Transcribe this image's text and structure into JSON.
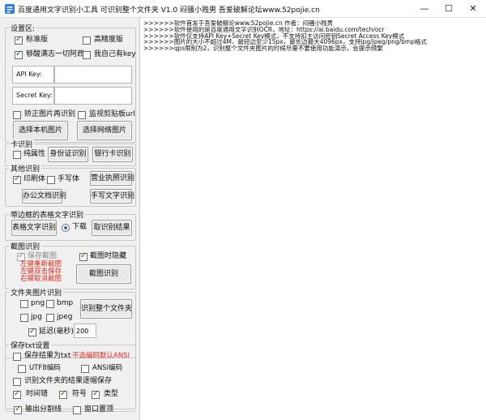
{
  "window": {
    "title": "百度通用文字识别小工具 可识别整个文件夹 V1.0  闷骚小贱男   吾爱破解论坛www.52pojie.cn",
    "minimize": "—",
    "maximize": "☐",
    "close": "✕"
  },
  "settings": {
    "group_title": "设置区:",
    "standard_label": "标准版",
    "standard_checked": true,
    "high_precision_label": "高精度版",
    "high_precision_checked": false,
    "use_author_key_label": "够酸满志一切阿西",
    "use_author_key_checked": true,
    "own_key_label": "我自己有key",
    "own_key_checked": false,
    "api_key_label": "API Key:",
    "api_key_value": "",
    "secret_key_label": "Secret Key:",
    "secret_key_value": "",
    "correct_rotation_label": "矫正图片再识别",
    "correct_rotation_checked": false,
    "watch_clipboard_label": "监视剪贴板url",
    "watch_clipboard_checked": false,
    "select_local_button": "选择本机图片",
    "select_web_button": "选择网络图片"
  },
  "card": {
    "group_title": "卡识别",
    "pure_attr_label": "纯属性",
    "pure_attr_checked": false,
    "id_card_button": "身份证识别",
    "bank_card_button": "银行卡识别"
  },
  "other": {
    "group_title": "其他识别",
    "printed_label": "印刷体",
    "printed_checked": true,
    "handwritten_label": "手写体",
    "handwritten_checked": false,
    "business_license_button": "营业执照识别",
    "office_doc_button": "办公文档识别",
    "handwriting_button": "手写文字识别"
  },
  "table": {
    "group_title": "带边框的表格文字识别",
    "table_button": "表格文字识别",
    "download_label": "下载",
    "download_selected": true,
    "result_button": "取识别结果"
  },
  "screenshot": {
    "group_title": "截图识别",
    "save_screenshot_label": "保存截图",
    "save_screenshot_checked": true,
    "mouse_follow_label": "截图时隐藏",
    "mouse_follow_checked": true,
    "hint_lines": [
      "左键重新截图",
      "左键双击保存",
      "右键取消截图"
    ],
    "screenshot_button": "截图识别"
  },
  "folder": {
    "group_title": "文件夹图片识别",
    "png_label": "png",
    "png_checked": false,
    "bmp_label": "bmp",
    "bmp_checked": false,
    "jpg_label": "jpg",
    "jpg_checked": false,
    "jpeg_label": "jpeg",
    "jpeg_checked": false,
    "whole_folder_button": "识别整个文件夹",
    "delay_label": "延迟(毫秒)",
    "delay_checked": true,
    "delay_value": "200"
  },
  "save_txt": {
    "group_title": "保存txt设置",
    "save_result_label": "保存结果为txt",
    "save_result_checked": false,
    "encoding_note": "不选编码默认ANSI",
    "utf8_label": "UTF8编码",
    "utf8_checked": false,
    "ansi_label": "ANSI编码",
    "ansi_checked": false,
    "folder_result_label": "识别文件夹的结果逐帽保存",
    "folder_result_checked": false,
    "timestamp_label": "时间错",
    "timestamp_checked": true,
    "symbol_label": "符号",
    "symbol_checked": true,
    "type_label": "类型",
    "type_checked": true
  },
  "bottom": {
    "output_separator_label": "输出分割线",
    "output_separator_checked": true,
    "window_topmost_label": "窗口置顶",
    "window_topmost_checked": false
  },
  "log": {
    "lines": [
      ">>>>>>软件首发于吾爱破解论www.52pojie.cn  作者：闷骚小贱男",
      ">>>>>>软件使用的是百度通用文字识别OCR，地址：https://ai.baidu.com/tech/ocr",
      ">>>>>>软件仅支持API Key+Secret Key模式，不支持扣主访问密钥Secret Access Key模式",
      ">>>>>>图片的大小不超过4M，最短边至少15px，最长边最大4096px，支持jpg/jpeg/png/bmp格式",
      ">>>>>>qps限制为2，识别整个文件夹图片的时候尽量不要使用功能演示，会提示频繁"
    ]
  },
  "colors": {
    "hint_red": "#e0261b",
    "check_green": "#1c6e1c",
    "radio_blue": "#1f6fd0"
  }
}
